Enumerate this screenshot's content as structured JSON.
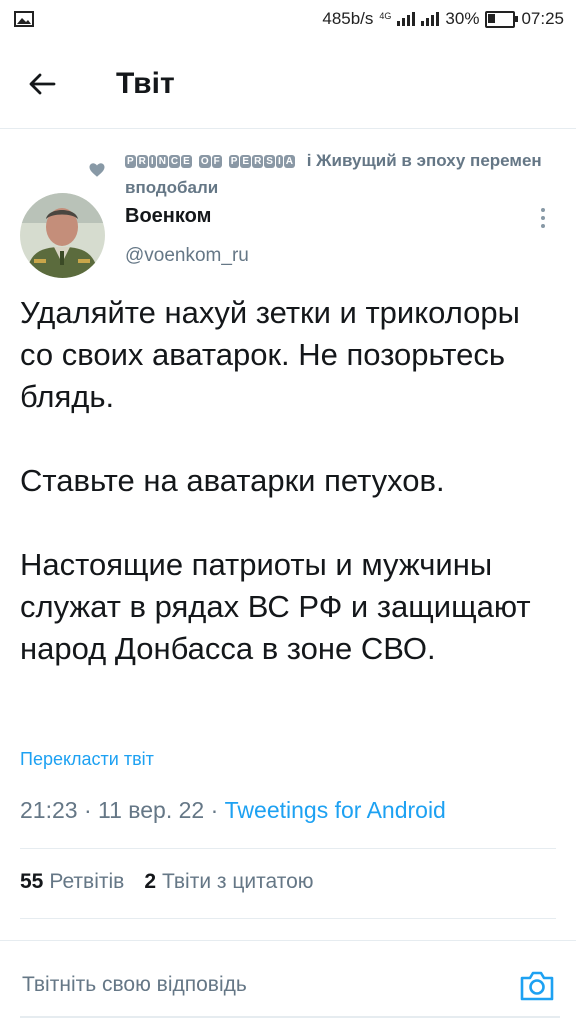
{
  "status_bar": {
    "speed": "485b/s",
    "network": "4G",
    "battery": "30%",
    "time": "07:25"
  },
  "header": {
    "title": "Твіт",
    "back_icon": "arrow-left-icon"
  },
  "social_context": {
    "badge_words": [
      "PRINCE",
      "OF",
      "PERSIA"
    ],
    "text": "і Живущий в эпоху перемен вподобали",
    "icon": "heart-icon"
  },
  "author": {
    "name": "Военком",
    "handle": "@voenkom_ru"
  },
  "tweet": {
    "paragraphs": [
      "Удаляйте нахуй зетки и триколоры со своих аватарок. Не позорьтесь блядь.",
      "Ставьте на аватарки петухов.",
      "Настоящие патриоты и мужчины служат в рядах ВС РФ и защищают народ Донбасса в зоне СВО."
    ],
    "translate_label": "Перекласти твіт",
    "time": "21:23",
    "date": "11 вер. 22",
    "separator": "·",
    "source": "Tweetings for Android"
  },
  "stats": {
    "retweets_count": "55",
    "retweets_label": "Ретвітів",
    "quotes_count": "2",
    "quotes_label": "Твіти з цитатою"
  },
  "reply": {
    "placeholder": "Твітніть свою відповідь",
    "camera_icon": "camera-icon"
  },
  "colors": {
    "accent": "#1da1f2",
    "secondary_text": "#657786",
    "primary_text": "#14171a",
    "divider": "#e6ecf0"
  }
}
